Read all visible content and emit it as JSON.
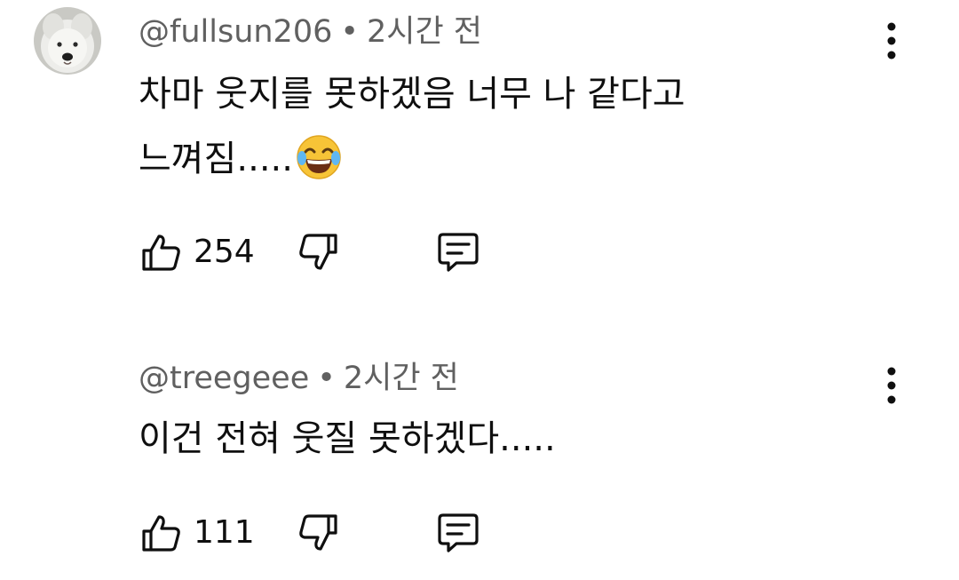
{
  "comments": [
    {
      "author": "@fullsun206",
      "separator": "•",
      "time": "2시간 전",
      "text_line1": "차마 웃지를 못하겠음 너무 나 같다고",
      "text_line2": "느껴짐.....",
      "emoji": "face-with-tears-of-joy",
      "likes": "254",
      "has_avatar": true
    },
    {
      "author": "@treegeee",
      "separator": "•",
      "time": "2시간 전",
      "text_line1": "이건 전혀 웃질 못하겠다.....",
      "likes": "111",
      "has_avatar": false
    }
  ],
  "icons": {
    "like": "thumbs-up-icon",
    "dislike": "thumbs-down-icon",
    "reply": "reply-comment-icon",
    "more": "more-vertical-icon"
  },
  "colors": {
    "primary_text": "#0f0f0f",
    "secondary_text": "#606060",
    "background": "#ffffff",
    "emoji_yellow": "#f7c437"
  }
}
